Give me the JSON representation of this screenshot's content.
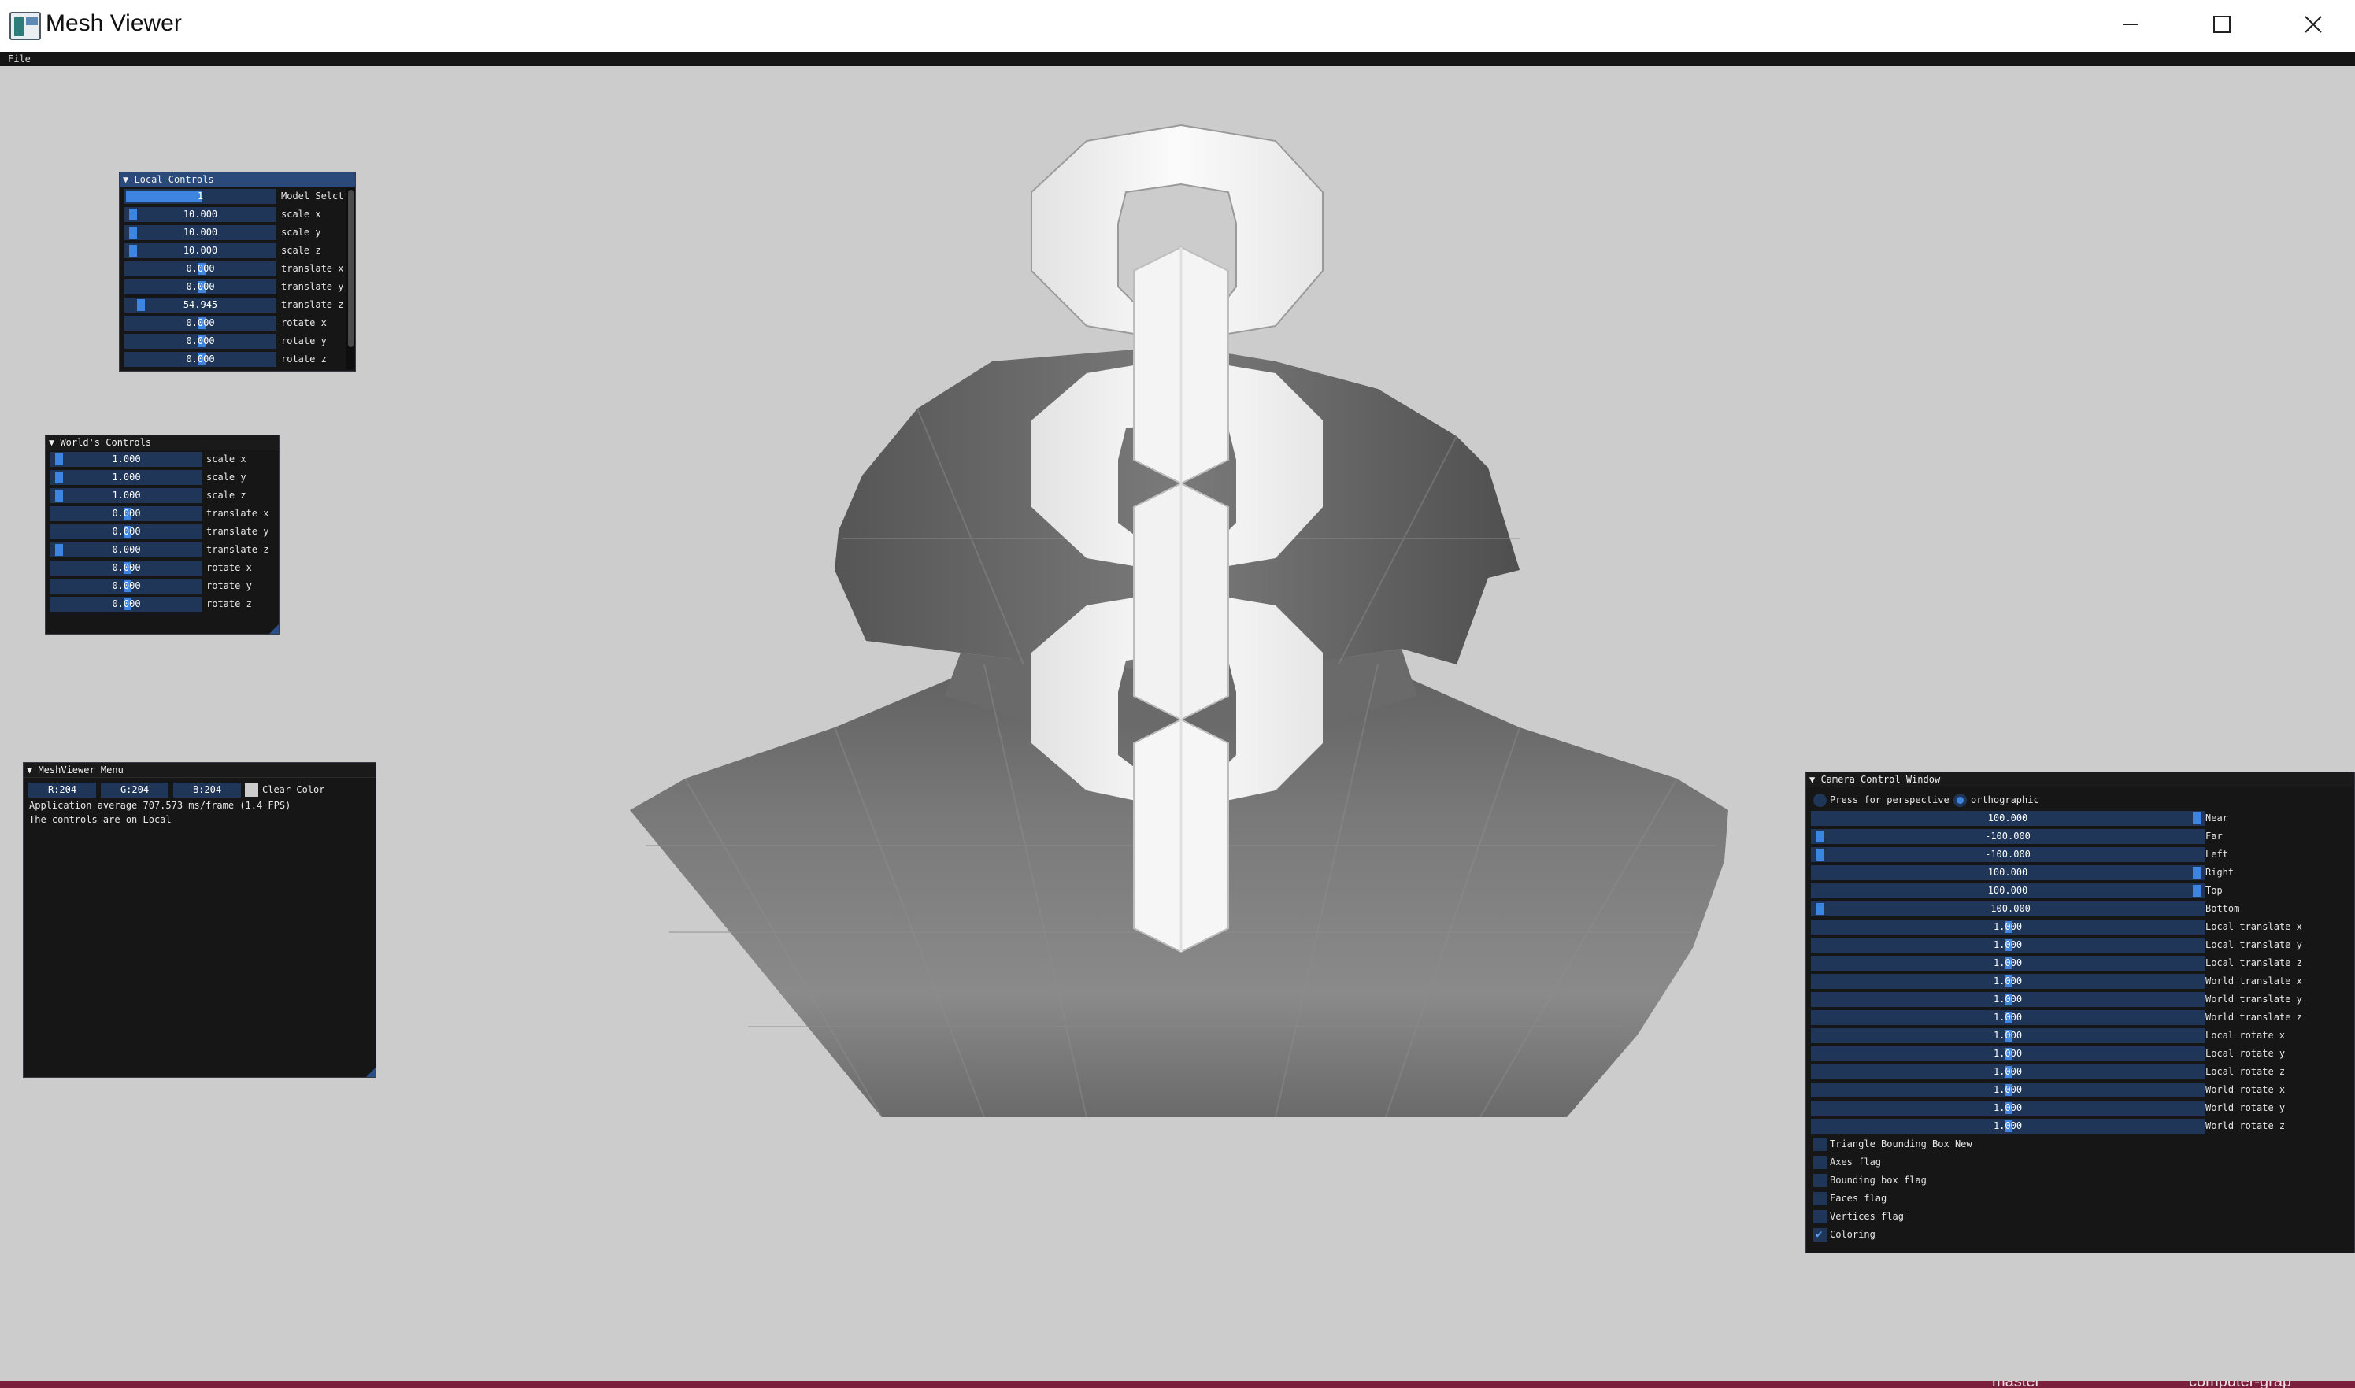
{
  "window": {
    "title": "Mesh Viewer",
    "icon": "mesh-viewer-app-icon",
    "controls": [
      "minimize-icon",
      "maximize-icon",
      "close-icon"
    ]
  },
  "menubar": {
    "file": "File"
  },
  "colors": {
    "background": "#cccccc",
    "panel_bg": "#161616",
    "slider_bg": "#1f3659",
    "slider_grab": "#3d85e0",
    "active_header": "#294a7a",
    "taskbar": "#7a1f3c"
  },
  "local_controls": {
    "title": "Local Controls",
    "rows": [
      {
        "value": "1",
        "label": "Model Selct",
        "fill": 0.5
      },
      {
        "value": "10.000",
        "label": "scale x",
        "fill": 0.02
      },
      {
        "value": "10.000",
        "label": "scale y",
        "fill": 0.02
      },
      {
        "value": "10.000",
        "label": "scale z",
        "fill": 0.02
      },
      {
        "value": "0.000",
        "label": "translate x",
        "fill": 0.5
      },
      {
        "value": "0.000",
        "label": "translate y",
        "fill": 0.5
      },
      {
        "value": "54.945",
        "label": "translate z",
        "fill": 0.08
      },
      {
        "value": "0.000",
        "label": "rotate x",
        "fill": 0.5
      },
      {
        "value": "0.000",
        "label": "rotate y",
        "fill": 0.5
      },
      {
        "value": "0.000",
        "label": "rotate z",
        "fill": 0.5
      }
    ]
  },
  "world_controls": {
    "title": "World's Controls",
    "rows": [
      {
        "value": "1.000",
        "label": "scale x",
        "fill": 0.02
      },
      {
        "value": "1.000",
        "label": "scale y",
        "fill": 0.02
      },
      {
        "value": "1.000",
        "label": "scale z",
        "fill": 0.02
      },
      {
        "value": "0.000",
        "label": "translate x",
        "fill": 0.5
      },
      {
        "value": "0.000",
        "label": "translate y",
        "fill": 0.5
      },
      {
        "value": "0.000",
        "label": "translate z",
        "fill": 0.02
      },
      {
        "value": "0.000",
        "label": "rotate x",
        "fill": 0.5
      },
      {
        "value": "0.000",
        "label": "rotate y",
        "fill": 0.5
      },
      {
        "value": "0.000",
        "label": "rotate z",
        "fill": 0.5
      }
    ]
  },
  "meshviewer_menu": {
    "title": "MeshViewer Menu",
    "r": "R:204",
    "g": "G:204",
    "b": "B:204",
    "clear_color_label": "Clear Color",
    "fps_text": "Application average 707.573 ms/frame (1.4 FPS)",
    "controls_text": "The controls are on Local"
  },
  "camera_control": {
    "title": "Camera Control Window",
    "perspective_label": "Press for perspective",
    "ortho_label": "orthographic",
    "ortho_selected": true,
    "rows": [
      {
        "value": "100.000",
        "label": "Near",
        "fill": 0.99
      },
      {
        "value": "-100.000",
        "label": "Far",
        "fill": 0.01
      },
      {
        "value": "-100.000",
        "label": "Left",
        "fill": 0.01
      },
      {
        "value": "100.000",
        "label": "Right",
        "fill": 0.99
      },
      {
        "value": "100.000",
        "label": "Top",
        "fill": 0.99
      },
      {
        "value": "-100.000",
        "label": "Bottom",
        "fill": 0.01
      },
      {
        "value": "1.000",
        "label": "Local translate x",
        "fill": 0.5
      },
      {
        "value": "1.000",
        "label": "Local translate y",
        "fill": 0.5
      },
      {
        "value": "1.000",
        "label": "Local translate z",
        "fill": 0.5
      },
      {
        "value": "1.000",
        "label": "World translate x",
        "fill": 0.5
      },
      {
        "value": "1.000",
        "label": "World translate y",
        "fill": 0.5
      },
      {
        "value": "1.000",
        "label": "World translate z",
        "fill": 0.5
      },
      {
        "value": "1.000",
        "label": "Local rotate x",
        "fill": 0.5
      },
      {
        "value": "1.000",
        "label": "Local rotate y",
        "fill": 0.5
      },
      {
        "value": "1.000",
        "label": "Local rotate z",
        "fill": 0.5
      },
      {
        "value": "1.000",
        "label": "World rotate x",
        "fill": 0.5
      },
      {
        "value": "1.000",
        "label": "World rotate y",
        "fill": 0.5
      },
      {
        "value": "1.000",
        "label": "World rotate z",
        "fill": 0.5
      }
    ],
    "checkboxes": [
      {
        "label": "Triangle Bounding Box New",
        "checked": false
      },
      {
        "label": "Axes flag",
        "checked": false
      },
      {
        "label": "Bounding box flag",
        "checked": false
      },
      {
        "label": "Faces flag",
        "checked": false
      },
      {
        "label": "Vertices flag",
        "checked": false
      },
      {
        "label": "Coloring",
        "checked": true
      }
    ]
  },
  "taskbar": {
    "branch": "master",
    "repo": "computer-grap"
  }
}
